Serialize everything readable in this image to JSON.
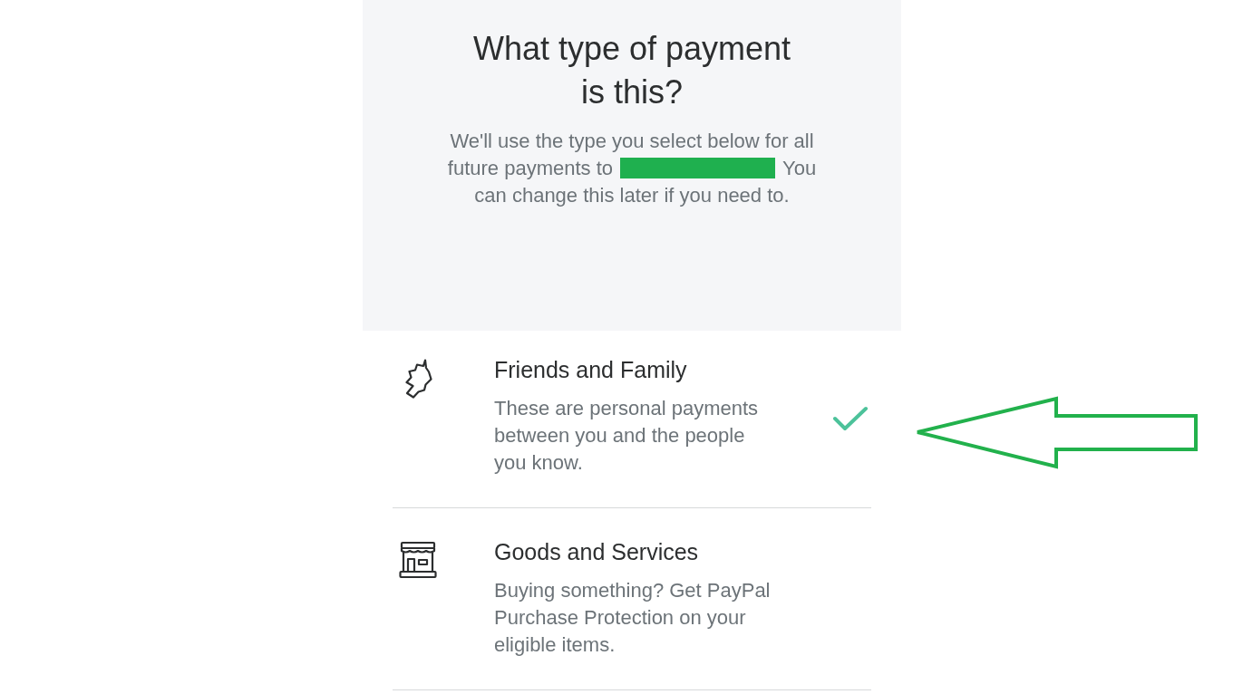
{
  "header": {
    "title": "What type of payment is this?",
    "description_before": "We'll use the type you select below for all future payments to",
    "recipient_redacted": true,
    "description_after": "You can change this later if you need to."
  },
  "options": [
    {
      "kind": "personal",
      "title": "Friends and Family",
      "description": "These are personal payments between you and the people you know.",
      "selected": true
    },
    {
      "kind": "commercial",
      "title": "Goods and Services",
      "description": "Buying something? Get PayPal Purchase Protection on your eligible items.",
      "selected": false
    }
  ]
}
